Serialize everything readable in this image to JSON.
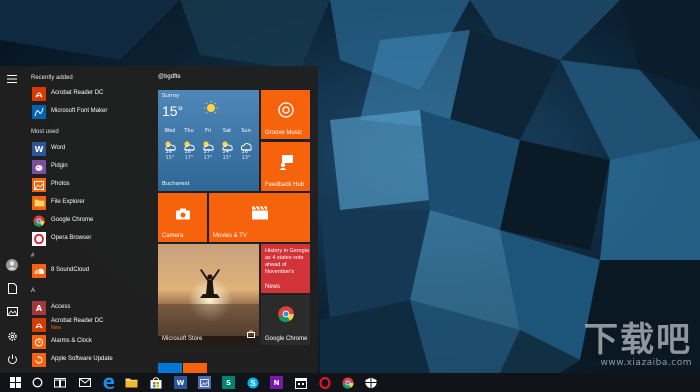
{
  "start_menu": {
    "sections": {
      "recently_added": "Recently added",
      "most_used": "Most used",
      "hash": "#",
      "letter_a": "A"
    },
    "recent_apps": [
      {
        "label": "Acrobat Reader DC",
        "icon": "acrobat-icon",
        "color": "#d83b01"
      },
      {
        "label": "Microsoft Font Maker",
        "icon": "font-maker-icon",
        "color": "#0063b1"
      }
    ],
    "most_used_apps": [
      {
        "label": "Word",
        "icon": "word-icon",
        "color": "#2b579a"
      },
      {
        "label": "Pidgin",
        "icon": "pidgin-icon",
        "color": "#7b4fa0"
      },
      {
        "label": "Photos",
        "icon": "photos-icon",
        "color": "#f7630c"
      },
      {
        "label": "File Explorer",
        "icon": "folder-icon",
        "color": "#f7630c"
      },
      {
        "label": "Google Chrome",
        "icon": "chrome-icon",
        "color": "#4285f4"
      },
      {
        "label": "Opera Browser",
        "icon": "opera-icon",
        "color": "#ffffff"
      }
    ],
    "hash_apps": [
      {
        "label": "8 SoundCloud",
        "icon": "soundcloud-icon",
        "color": "#f7630c"
      }
    ],
    "a_apps": [
      {
        "label": "Access",
        "icon": "access-icon",
        "color": "#a4373a"
      },
      {
        "label": "Acrobat Reader DC",
        "sub": "New",
        "icon": "acrobat-icon",
        "color": "#d83b01"
      },
      {
        "label": "Alarms & Clock",
        "icon": "alarm-icon",
        "color": "#f7630c"
      },
      {
        "label": "Apple Software Update",
        "icon": "apple-update-icon",
        "color": "#f7630c"
      }
    ],
    "tile_group": "@bgdfte",
    "weather": {
      "condition": "Sunny",
      "temperature": "15°",
      "city": "Bucharest",
      "forecast": [
        {
          "day": "Wed",
          "hi": "26°",
          "lo": "15°",
          "icon": "partly-cloudy-icon"
        },
        {
          "day": "Thu",
          "hi": "28°",
          "lo": "17°",
          "icon": "partly-cloudy-icon"
        },
        {
          "day": "Fri",
          "hi": "27°",
          "lo": "17°",
          "icon": "partly-cloudy-icon"
        },
        {
          "day": "Sat",
          "hi": "24°",
          "lo": "15°",
          "icon": "partly-cloudy-icon"
        },
        {
          "day": "Sun",
          "hi": "26°",
          "lo": "13°",
          "icon": "cloudy-icon"
        }
      ]
    },
    "tiles": {
      "groove": "Groove Music",
      "feedback": "Feedback Hub",
      "camera": "Camera",
      "movies": "Movies & TV",
      "news_headline": "History in Georgia as 4 states vote ahead of November's",
      "news": "News",
      "store": "Microsoft Store",
      "chrome": "Google Chrome"
    },
    "colors": {
      "accent": "#f7630c",
      "news_red": "#d13438",
      "menu_bg": "#202020"
    }
  },
  "taskbar": {
    "icons": [
      "start-icon",
      "cortana-icon",
      "task-view-icon",
      "mail-icon",
      "edge-icon",
      "file-explorer-icon",
      "store-icon",
      "photos-icon",
      "word-icon",
      "sway-icon",
      "skype-icon",
      "onenote-icon",
      "calendar-icon",
      "opera-icon",
      "chrome-icon",
      "settings-icon"
    ]
  },
  "watermark": {
    "text": "下载吧",
    "url": "www.xiazaiba.com"
  }
}
